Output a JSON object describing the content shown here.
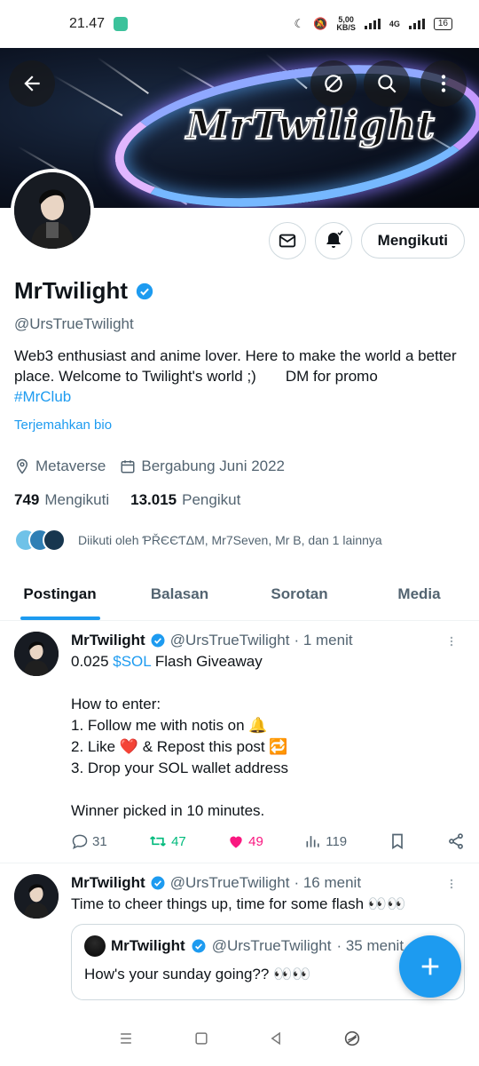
{
  "status": {
    "time": "21.47",
    "net_speed_top": "5,00",
    "net_speed_bottom": "KB/S",
    "network": "4G",
    "battery": "16"
  },
  "banner": {
    "brand_text": "MrTwilight"
  },
  "profile": {
    "follow_label": "Mengikuti",
    "name": "MrTwilight",
    "handle": "@UrsTrueTwilight",
    "bio_text": "Web3 enthusiast and anime lover. Here to make the world a better place. Welcome to Twilight's world ;)       DM for promo",
    "bio_tag": "#MrClub",
    "translate_label": "Terjemahkan bio",
    "location": "Metaverse",
    "joined": "Bergabung Juni 2022",
    "following_count": "749",
    "following_label": "Mengikuti",
    "followers_count": "13.015",
    "followers_label": "Pengikut",
    "followed_by": "Diikuti oleh ƤŘЄЄƬΔM, Mr7Seven, Mr B, dan 1 lainnya"
  },
  "tabs": [
    {
      "label": "Postingan",
      "active": true
    },
    {
      "label": "Balasan",
      "active": false
    },
    {
      "label": "Sorotan",
      "active": false
    },
    {
      "label": "Media",
      "active": false
    }
  ],
  "posts": [
    {
      "name": "MrTwilight",
      "handle": "@UrsTrueTwilight",
      "time": "· 1 menit",
      "text_pre": "0.025 ",
      "text_link": "$SOL",
      "text_post": " Flash Giveaway\n\nHow to enter:\n1. Follow me with notis on 🔔\n2. Like ❤️ & Repost this post 🔁\n3. Drop your SOL wallet address\n\nWinner picked in 10 minutes.",
      "replies": "31",
      "reposts": "47",
      "likes": "49",
      "views": "119"
    },
    {
      "name": "MrTwilight",
      "handle": "@UrsTrueTwilight",
      "time": "· 16 menit",
      "text": "Time to cheer things up, time for some flash 👀👀",
      "quote": {
        "name": "MrTwilight",
        "handle": "@UrsTrueTwilight",
        "time": "· 35 menit",
        "text": "How's your sunday going?? 👀👀"
      }
    }
  ],
  "colors": {
    "accent": "#1d9bf0",
    "repost": "#00ba7c",
    "like": "#f91880"
  }
}
